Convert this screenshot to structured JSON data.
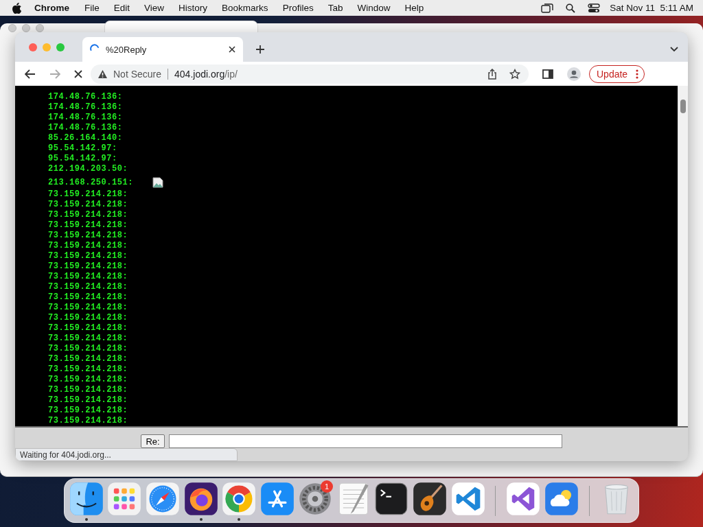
{
  "menu_bar": {
    "app": "Chrome",
    "menus": [
      "File",
      "Edit",
      "View",
      "History",
      "Bookmarks",
      "Profiles",
      "Tab",
      "Window",
      "Help"
    ],
    "clock": "Sat Nov 11  5:11 AM"
  },
  "browser": {
    "tabs": [
      {
        "title": "%20Reply",
        "selected": true,
        "loading": true
      }
    ],
    "address": {
      "security": "Not Secure",
      "host": "404.jodi.org",
      "path": "/ip/"
    },
    "update_label": "Update",
    "page": {
      "lines": [
        {
          "text": "174.48.76.136:"
        },
        {
          "text": "174.48.76.136:"
        },
        {
          "text": "174.48.76.136:"
        },
        {
          "text": "174.48.76.136:"
        },
        {
          "text": "85.26.164.140:"
        },
        {
          "text": "95.54.142.97:"
        },
        {
          "text": "95.54.142.97:"
        },
        {
          "text": "212.194.203.50:"
        },
        {
          "text": "213.168.250.151:",
          "broken_image": true
        },
        {
          "text": "73.159.214.218:"
        },
        {
          "text": "73.159.214.218:"
        },
        {
          "text": "73.159.214.218:"
        },
        {
          "text": "73.159.214.218:"
        },
        {
          "text": "73.159.214.218:"
        },
        {
          "text": "73.159.214.218:"
        },
        {
          "text": "73.159.214.218:"
        },
        {
          "text": "73.159.214.218:"
        },
        {
          "text": "73.159.214.218:"
        },
        {
          "text": "73.159.214.218:"
        },
        {
          "text": "73.159.214.218:"
        },
        {
          "text": "73.159.214.218:"
        },
        {
          "text": "73.159.214.218:"
        },
        {
          "text": "73.159.214.218:"
        },
        {
          "text": "73.159.214.218:"
        },
        {
          "text": "73.159.214.218:"
        },
        {
          "text": "73.159.214.218:"
        },
        {
          "text": "73.159.214.218:"
        },
        {
          "text": "73.159.214.218:"
        },
        {
          "text": "73.159.214.218:"
        },
        {
          "text": "73.159.214.218:"
        },
        {
          "text": "73.159.214.218:"
        },
        {
          "text": "73.159.214.218:"
        }
      ],
      "reply_button": "Re:"
    },
    "status": "Waiting for 404.jodi.org..."
  },
  "dock": {
    "apps": [
      {
        "kind": "finder",
        "running": true
      },
      {
        "kind": "launchpad",
        "running": false
      },
      {
        "kind": "safari",
        "running": false
      },
      {
        "kind": "firefox",
        "running": true
      },
      {
        "kind": "chrome",
        "running": true
      },
      {
        "kind": "appstore",
        "running": false
      },
      {
        "kind": "settings",
        "running": false,
        "badge": "1"
      },
      {
        "kind": "textedit",
        "running": false
      },
      {
        "kind": "terminal",
        "running": false
      },
      {
        "kind": "garageband",
        "running": false
      },
      {
        "kind": "vscode",
        "running": false
      },
      {
        "kind": "divider"
      },
      {
        "kind": "visualstudio",
        "running": false
      },
      {
        "kind": "weather",
        "running": false
      },
      {
        "kind": "divider"
      },
      {
        "kind": "trash",
        "running": false
      }
    ]
  }
}
